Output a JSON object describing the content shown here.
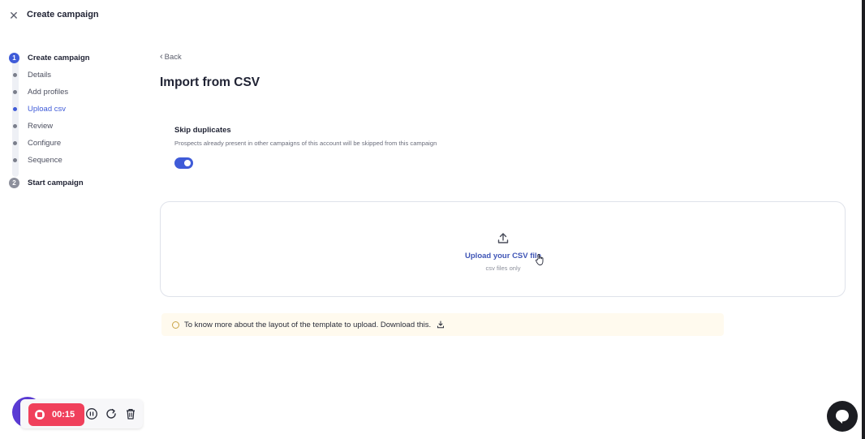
{
  "header": {
    "title": "Create campaign",
    "close_icon": "close-icon"
  },
  "stepper": {
    "step1": {
      "number": "1",
      "label": "Create campaign"
    },
    "substeps": [
      {
        "label": "Details"
      },
      {
        "label": "Add profiles"
      },
      {
        "label": "Upload csv",
        "active": true
      },
      {
        "label": "Review"
      },
      {
        "label": "Configure"
      },
      {
        "label": "Sequence"
      }
    ],
    "step2": {
      "number": "2",
      "label": "Start campaign"
    },
    "accent": "#3f5bd8"
  },
  "main": {
    "back_label": "Back",
    "title": "Import from CSV",
    "skip": {
      "title": "Skip duplicates",
      "description": "Prospects already present in other campaigns of this account will be skipped from this campaign",
      "enabled": true
    },
    "upload": {
      "title": "Upload your CSV file",
      "subtitle": "csv files only",
      "icon": "upload-icon"
    },
    "info": {
      "text": "To know more about the layout of the template to upload. Download this.",
      "icon": "info-icon",
      "download_icon": "download-icon"
    }
  },
  "recorder": {
    "time": "00:15",
    "accent": "#f0405b",
    "controls": [
      "pause-icon",
      "restart-icon",
      "trash-icon"
    ]
  },
  "chat": {
    "icon": "chat-icon"
  }
}
